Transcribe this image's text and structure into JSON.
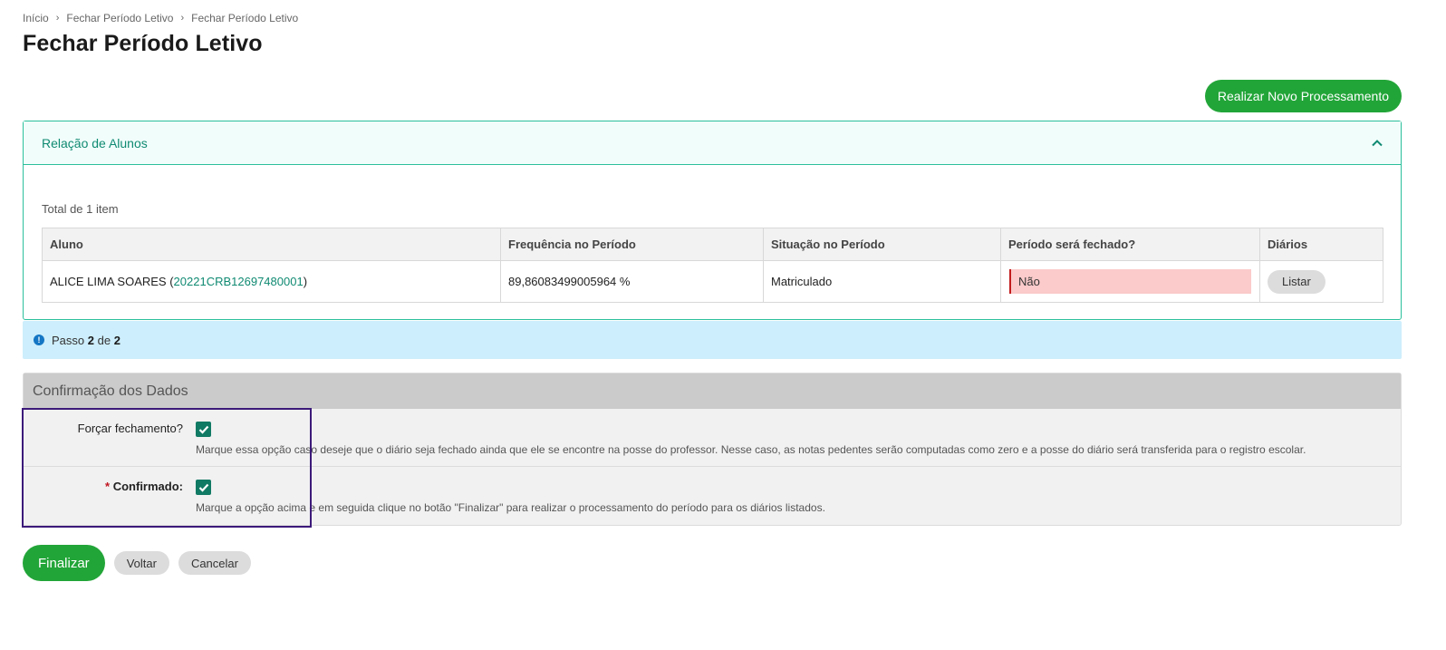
{
  "breadcrumb": [
    {
      "label": "Início"
    },
    {
      "label": "Fechar Período Letivo"
    },
    {
      "label": "Fechar Período Letivo"
    }
  ],
  "page_title": "Fechar Período Letivo",
  "new_processing_button": "Realizar Novo Processamento",
  "students_panel": {
    "title": "Relação de Alunos",
    "total_text": "Total de 1 item",
    "columns": [
      "Aluno",
      "Frequência no Período",
      "Situação no Período",
      "Período será fechado?",
      "Diários"
    ],
    "rows": [
      {
        "student_name_prefix": "ALICE LIMA SOARES (",
        "student_id": "20221CRB12697480001",
        "student_name_suffix": ")",
        "frequency": "89,86083499005964 %",
        "situation": "Matriculado",
        "will_close": "Não",
        "diaries_button": "Listar"
      }
    ]
  },
  "step_info": {
    "prefix": "Passo",
    "current": "2",
    "of": "de",
    "total": "2"
  },
  "confirmation": {
    "title": "Confirmação dos Dados",
    "force_label": "Forçar fechamento?",
    "force_checked": true,
    "force_help": "Marque essa opção caso deseje que o diário seja fechado ainda que ele se encontre na posse do professor. Nesse caso, as notas pedentes serão computadas como zero e a posse do diário será transferida para o registro escolar.",
    "confirmed_required_mark": "*",
    "confirmed_label": "Confirmado:",
    "confirmed_checked": true,
    "confirmed_help": "Marque a opção acima e em seguida clique no botão \"Finalizar\" para realizar o processamento do período para os diários listados."
  },
  "actions": {
    "finish": "Finalizar",
    "back": "Voltar",
    "cancel": "Cancelar"
  },
  "colors": {
    "primary_green": "#22a538",
    "teal_accent": "#108a72",
    "info_bg": "#cdeefc",
    "danger_bg": "#fbcaca",
    "highlight_border": "#3c1a7a"
  }
}
